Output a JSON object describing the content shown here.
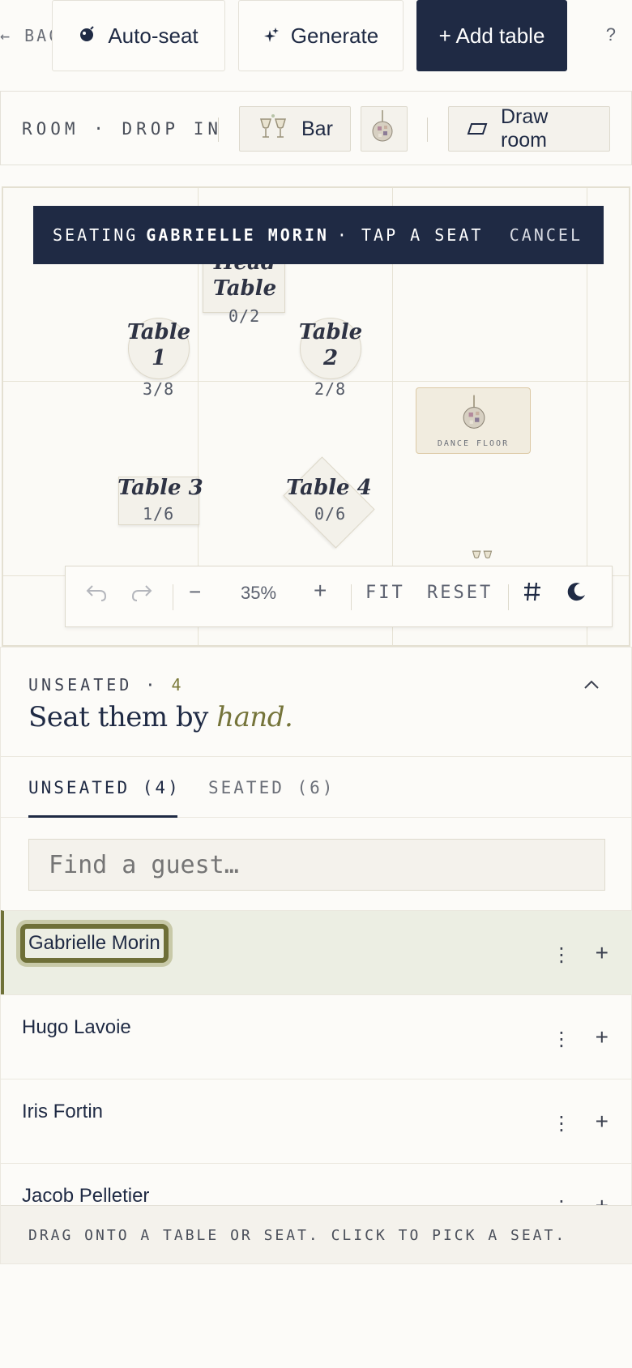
{
  "toolbar": {
    "back_label": "← BAC",
    "autoseat_label": "Auto-seat",
    "generate_label": "Generate",
    "add_table_label": "+ Add table",
    "help_label": "?"
  },
  "dropin": {
    "label": "ROOM · DROP IN",
    "items": [
      {
        "label": "Bar"
      }
    ],
    "draw_room_label": "Draw room"
  },
  "canvas": {
    "banner": {
      "prefix": "SEATING",
      "guest": "GABRIELLE MORIN",
      "suffix": "· TAP A SEAT",
      "cancel": "CANCEL"
    },
    "tables": [
      {
        "name": "Head Table",
        "count": "0/2"
      },
      {
        "name": "Table 1",
        "count": "3/8"
      },
      {
        "name": "Table 2",
        "count": "2/8"
      },
      {
        "name": "Table 3",
        "count": "1/6"
      },
      {
        "name": "Table 4",
        "count": "0/6"
      }
    ],
    "dance_floor_label": "DANCE FLOOR",
    "zoom": {
      "value": "35%",
      "fit": "FIT",
      "reset": "RESET"
    }
  },
  "unseated": {
    "kicker_label": "UNSEATED ·",
    "kicker_count": "4",
    "heading_main": "Seat them by",
    "heading_em": "hand.",
    "tabs": [
      {
        "label": "UNSEATED (4)",
        "active": true
      },
      {
        "label": "SEATED (6)",
        "active": false
      }
    ],
    "search_placeholder": "Find a guest…",
    "guests": [
      {
        "name": "Gabrielle Morin",
        "selected": true
      },
      {
        "name": "Hugo Lavoie",
        "selected": false
      },
      {
        "name": "Iris Fortin",
        "selected": false
      },
      {
        "name": "Jacob Pelletier",
        "selected": false
      }
    ],
    "footer_hint": "DRAG ONTO A TABLE OR SEAT. CLICK TO PICK A SEAT."
  },
  "colors": {
    "navy": "#1f2a44",
    "olive": "#6e6f37",
    "paper": "#fcfbf8"
  },
  "icons": [
    "arrow-left-icon",
    "bomb-icon",
    "sparkle-icon",
    "champagne-icon",
    "disco-ball-icon",
    "parallelogram-icon",
    "undo-icon",
    "redo-icon",
    "minus-icon",
    "plus-icon",
    "grid-hash-icon",
    "moon-icon",
    "chevron-up-icon",
    "more-vertical-icon"
  ]
}
